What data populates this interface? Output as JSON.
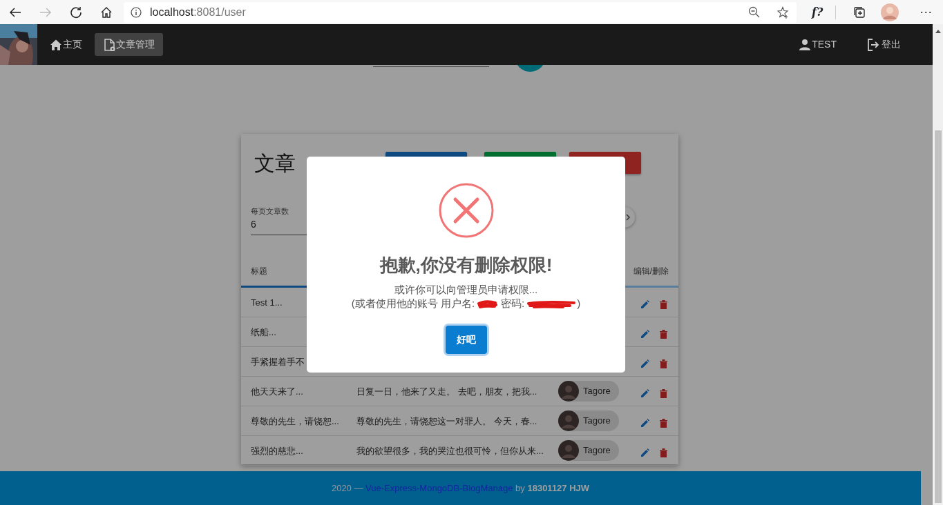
{
  "browser": {
    "url_host": "localhost",
    "url_rest": ":8081/user",
    "extension_label": "f?",
    "menu_label": "···"
  },
  "navbar": {
    "items": [
      {
        "label": "主页",
        "kind": "home",
        "selected": false
      },
      {
        "label": "文章管理",
        "kind": "document",
        "selected": true
      }
    ],
    "user": "TEST",
    "logout": "登出"
  },
  "card": {
    "title": "文章",
    "buttons": [
      {
        "kind": "primary"
      },
      {
        "kind": "success"
      },
      {
        "kind": "danger"
      }
    ],
    "page_size": {
      "label": "每页文章数",
      "value": "6"
    },
    "columns": [
      {
        "label": "标题"
      },
      {
        "label": "编辑/删除"
      }
    ],
    "rows": [
      {
        "title": "Test 1..."
      },
      {
        "title": "纸船..."
      },
      {
        "title": "手紧握着手不"
      },
      {
        "title": "他天天来了...",
        "content": "日复一日，他来了又走。 去吧，朋友，把我...",
        "author": "Tagore"
      },
      {
        "title": "尊敬的先生，请饶恕...",
        "content": "尊敬的先生，请饶恕这一对罪人。 今天，春...",
        "author": "Tagore"
      },
      {
        "title": "强烈的慈悲...",
        "content": "我的欲望很多，我的哭泣也很可怜，但你从来...",
        "author": "Tagore"
      }
    ]
  },
  "modal": {
    "title": "抱歉,你没有删除权限!",
    "message": "或许你可以向管理员申请权限...",
    "hint_prefix": "(或者使用他的账号 用户名:",
    "hint_password": "密码:",
    "hint_suffix": ")",
    "confirm": "好吧"
  },
  "footer": {
    "before": "2020 —",
    "link": "Vue-Express-MongoDB-BlogManage",
    "after": "by **18301127 HJW**"
  }
}
